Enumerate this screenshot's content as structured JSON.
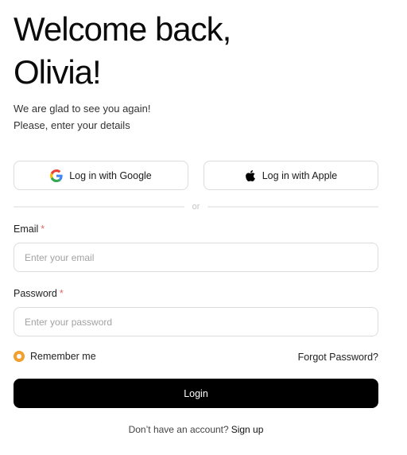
{
  "header": {
    "title_line1": "Welcome back,",
    "title_line2": "Olivia!",
    "subtitle_line1": "We are glad to see you again!",
    "subtitle_line2": "Please, enter your details"
  },
  "social": {
    "google_label": "Log in with Google",
    "google_icon": "google-icon",
    "apple_label": "Log in with Apple",
    "apple_icon": "apple-icon"
  },
  "divider": {
    "label": "or"
  },
  "form": {
    "email_label": "Email",
    "email_required_mark": "*",
    "email_value": "",
    "email_placeholder": "Enter your email",
    "password_label": "Password",
    "password_required_mark": "*",
    "password_value": "",
    "password_placeholder": "Enter your password",
    "remember_label": "Remember me",
    "remember_checked": true,
    "forgot_label": "Forgot Password?",
    "submit_label": "Login"
  },
  "footer": {
    "prompt": "Don’t have an account?",
    "signup_label": "Sign up"
  },
  "colors": {
    "accent": "#f0a030",
    "required": "#e06a6a",
    "primary_button": "#000000",
    "google_blue": "#4285F4",
    "google_red": "#EA4335",
    "google_yellow": "#FBBC05",
    "google_green": "#34A853"
  }
}
